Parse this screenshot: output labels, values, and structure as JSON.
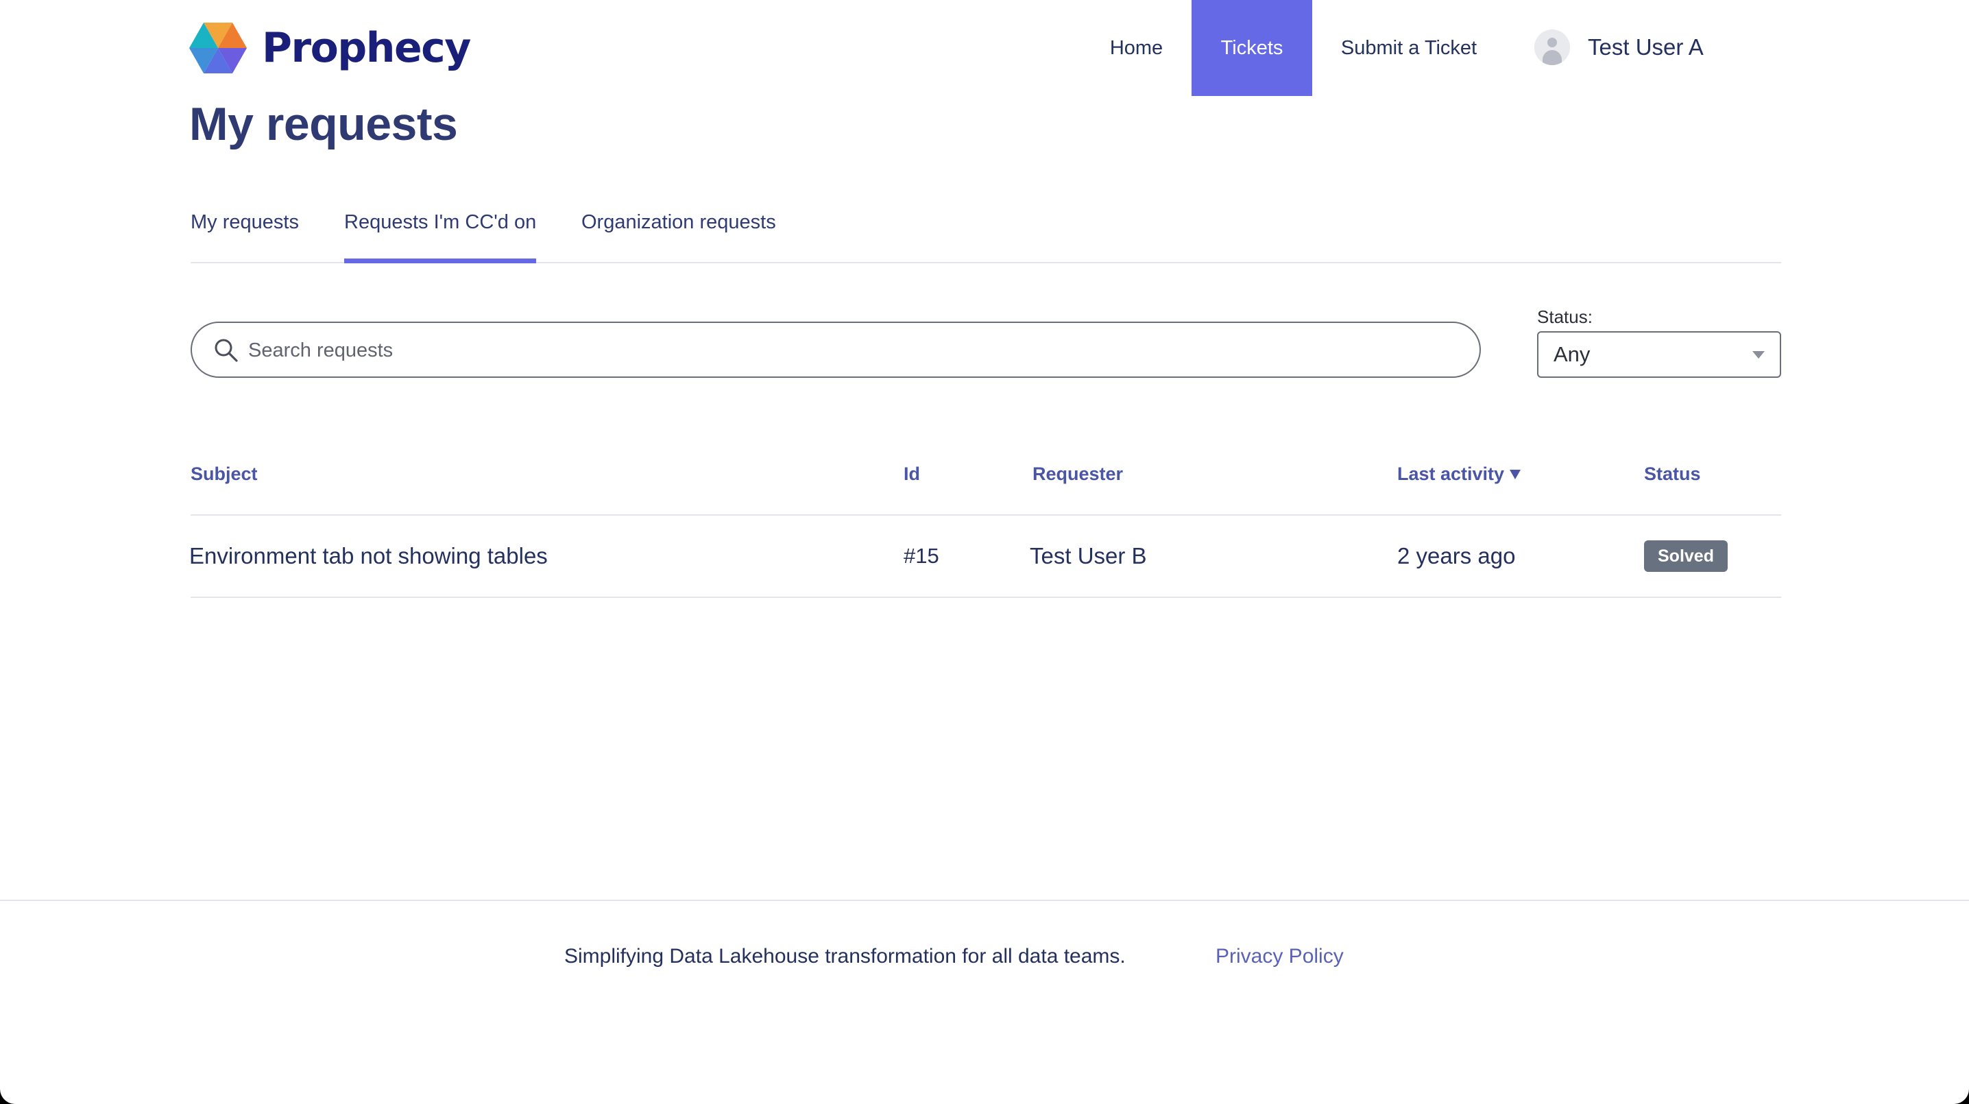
{
  "header": {
    "brand": "Prophecy",
    "nav": {
      "home": "Home",
      "tickets": "Tickets",
      "submit": "Submit a Ticket"
    },
    "user_name": "Test User A",
    "colors": {
      "accent": "#6669e6",
      "brand_text": "#1a1f7a"
    }
  },
  "page": {
    "title": "My requests"
  },
  "tabs": [
    {
      "label": "My requests",
      "active": false
    },
    {
      "label": "Requests I'm CC'd on",
      "active": true
    },
    {
      "label": "Organization requests",
      "active": false
    }
  ],
  "search": {
    "placeholder": "Search requests",
    "value": ""
  },
  "filter": {
    "status_label": "Status:",
    "status_value": "Any"
  },
  "table": {
    "columns": {
      "subject": "Subject",
      "id": "Id",
      "requester": "Requester",
      "last_activity": "Last activity",
      "status": "Status"
    },
    "sorted_by": "last_activity",
    "rows": [
      {
        "subject": "Environment tab not showing tables",
        "id": "#15",
        "requester": "Test User B",
        "last_activity": "2 years ago",
        "status": "Solved"
      }
    ]
  },
  "footer": {
    "tagline": "Simplifying Data Lakehouse transformation for all data teams.",
    "privacy": "Privacy Policy"
  },
  "icons": {
    "logo": "prophecy-hexagon-logo",
    "user": "user-avatar-icon",
    "search": "search-icon",
    "dropdown": "chevron-down-icon",
    "sort": "sort-descending-icon"
  }
}
